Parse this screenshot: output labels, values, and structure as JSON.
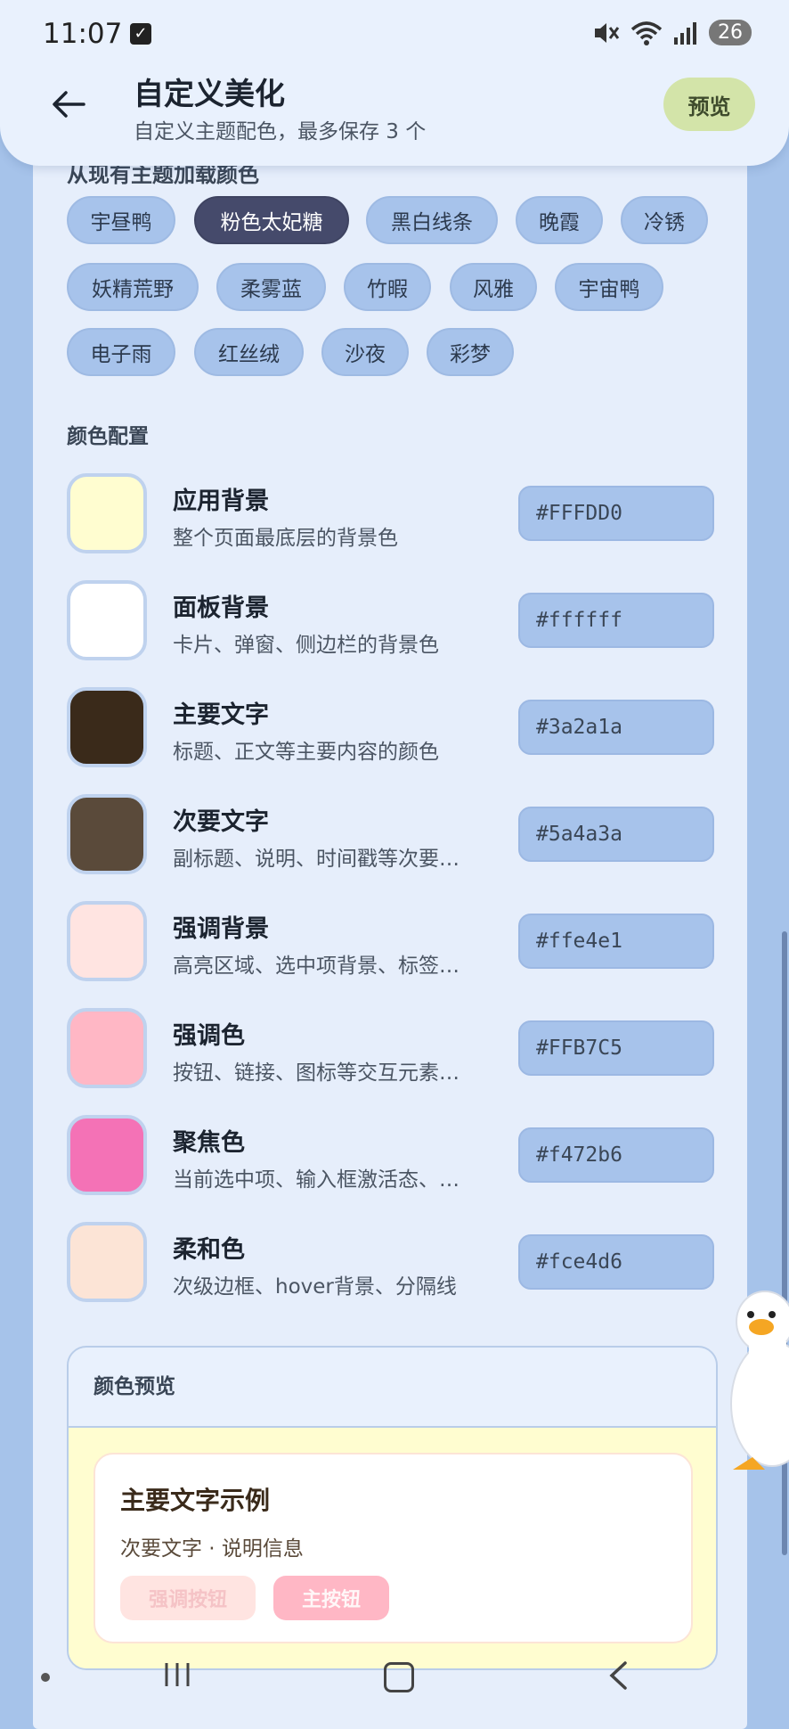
{
  "status_bar": {
    "time": "11:07",
    "battery": "26"
  },
  "header": {
    "title": "自定义美化",
    "subtitle": "自定义主题配色，最多保存 3 个",
    "preview_button": "预览"
  },
  "theme_section": {
    "heading": "从现有主题加载颜色",
    "chips": [
      "宇昼鸭",
      "粉色太妃糖",
      "黑白线条",
      "晚霞",
      "冷锈",
      "妖精荒野",
      "柔雾蓝",
      "竹暇",
      "风雅",
      "宇宙鸭",
      "电子雨",
      "红丝绒",
      "沙夜",
      "彩梦"
    ],
    "selected": "粉色太妃糖"
  },
  "color_config": {
    "heading": "颜色配置",
    "rows": [
      {
        "name": "应用背景",
        "desc": "整个页面最底层的背景色",
        "hex": "#FFFDD0"
      },
      {
        "name": "面板背景",
        "desc": "卡片、弹窗、侧边栏的背景色",
        "hex": "#ffffff"
      },
      {
        "name": "主要文字",
        "desc": "标题、正文等主要内容的颜色",
        "hex": "#3a2a1a"
      },
      {
        "name": "次要文字",
        "desc": "副标题、说明、时间戳等次要…",
        "hex": "#5a4a3a"
      },
      {
        "name": "强调背景",
        "desc": "高亮区域、选中项背景、标签…",
        "hex": "#ffe4e1"
      },
      {
        "name": "强调色",
        "desc": "按钮、链接、图标等交互元素…",
        "hex": "#FFB7C5"
      },
      {
        "name": "聚焦色",
        "desc": "当前选中项、输入框激活态、…",
        "hex": "#f472b6"
      },
      {
        "name": "柔和色",
        "desc": "次级边框、hover背景、分隔线",
        "hex": "#fce4d6"
      }
    ]
  },
  "preview": {
    "heading": "颜色预览",
    "sample_title": "主要文字示例",
    "sample_sub": "次要文字 · 说明信息",
    "accent_button": "强调按钮",
    "primary_button": "主按钮"
  }
}
